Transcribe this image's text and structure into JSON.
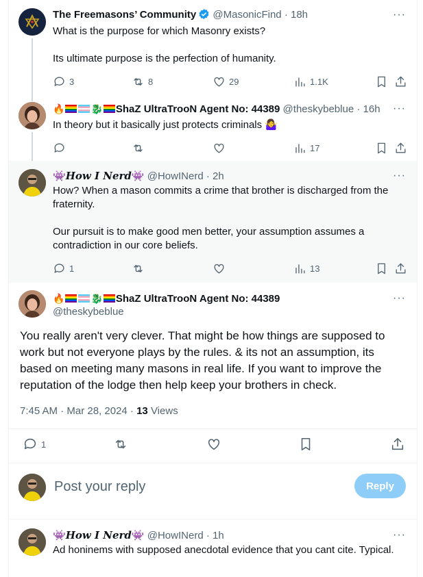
{
  "posts": [
    {
      "name": "The Freemasons’ Community",
      "handle": "@MasonicFind",
      "time": "18h",
      "text": "What is the purpose for which Masonry exists?\n\nIts ultimate purpose is the perfection of humanity.",
      "replies": "3",
      "reposts": "8",
      "likes": "29",
      "views": "1.1K"
    },
    {
      "name_suffix": "ShaZ UltraTrooN Agent No: 44389",
      "handle": "@theskybeblue",
      "time": "16h",
      "text": "In theory but it basically just protects criminals",
      "emoji_end": "🤷‍♀️",
      "views": "17"
    },
    {
      "name": "How I Nerd",
      "handle": "@HowINerd",
      "time": "2h",
      "text": "How? When a mason commits a crime that brother is discharged from the fraternity.\n\nOur pursuit is to make good men better, your assumption assumes a contradiction in  our core beliefs.",
      "replies": "1",
      "views": "13"
    }
  ],
  "focus": {
    "name_suffix": "ShaZ UltraTrooN Agent No: 44389",
    "handle": "@theskybeblue",
    "text": "You really aren't very clever. That might be how things are supposed to work but not everyone plays by the rules. & its not an assumption, its based on meeting many masons in real life. If you want to improve the reputation of the lodge then help keep your brothers in check.",
    "timestamp": "7:45 AM · Mar 28, 2024 · ",
    "views_count": "13",
    "views_label": " Views",
    "replies": "1"
  },
  "reply_box": {
    "placeholder": "Post your reply",
    "button": "Reply"
  },
  "last_post": {
    "name": "How I Nerd",
    "handle": "@HowINerd",
    "time": "1h",
    "text": "Ad honinems with supposed anecdotal evidence that you cant cite. Typical."
  },
  "dot": "·",
  "colors": {
    "accent": "#1d9bf0",
    "reply_button": "#8ecdf8",
    "text": "#0f1419",
    "muted": "#536471"
  }
}
